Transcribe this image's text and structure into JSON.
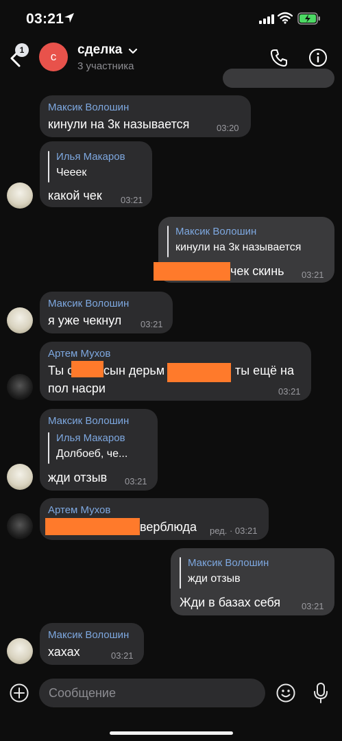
{
  "status_bar": {
    "time": "03:21"
  },
  "header": {
    "back_badge": "1",
    "avatar_letter": "с",
    "title": "сделка",
    "subtitle": "3 участника"
  },
  "messages": [
    {
      "sender": "Максик Волошин",
      "text": "кинули на 3к называется",
      "time": "03:20"
    },
    {
      "sender": "Илья Макаров",
      "quote_text": "Чееек",
      "text": "какой чек",
      "time": "03:21"
    },
    {
      "quote_name": "Максик Волошин",
      "quote_text": "кинули на 3к называется",
      "text": "чек скинь",
      "time": "03:21"
    },
    {
      "sender": "Максик Волошин",
      "text": "я уже чекнул",
      "time": "03:21"
    },
    {
      "sender": "Артем Мухов",
      "text_a": "Ты с",
      "text_b": "сын дерьм",
      "text_c": "ты ещё на",
      "text_line2": "пол насри",
      "time": "03:21"
    },
    {
      "sender": "Максик Волошин",
      "quote_name": "Илья Макаров",
      "quote_text": "Долбоеб, че...",
      "text": "жди отзыв",
      "time": "03:21"
    },
    {
      "sender": "Артем Мухов",
      "text": "верблюда",
      "time": "ред. · 03:21"
    },
    {
      "quote_name": "Максик Волошин",
      "quote_text": "жди отзыв",
      "text": "Жди в базах себя",
      "time": "03:21"
    },
    {
      "sender": "Максик Волошин",
      "text": "хахах",
      "time": "03:21"
    }
  ],
  "composer": {
    "placeholder": "Сообщение"
  },
  "icons": [
    "location-arrow-icon",
    "signal-icon",
    "wifi-icon",
    "battery-icon",
    "back-chevron-icon",
    "chevron-down-icon",
    "phone-icon",
    "info-icon",
    "plus-icon",
    "emoji-icon",
    "mic-icon"
  ],
  "colors": {
    "background": "#0d0d0d",
    "bubble_in": "#2c2c2e",
    "bubble_out": "#3a3a3c",
    "sender_name": "#7ea8e0",
    "avatar_red": "#e8524b",
    "redaction": "#ff7a2b"
  }
}
